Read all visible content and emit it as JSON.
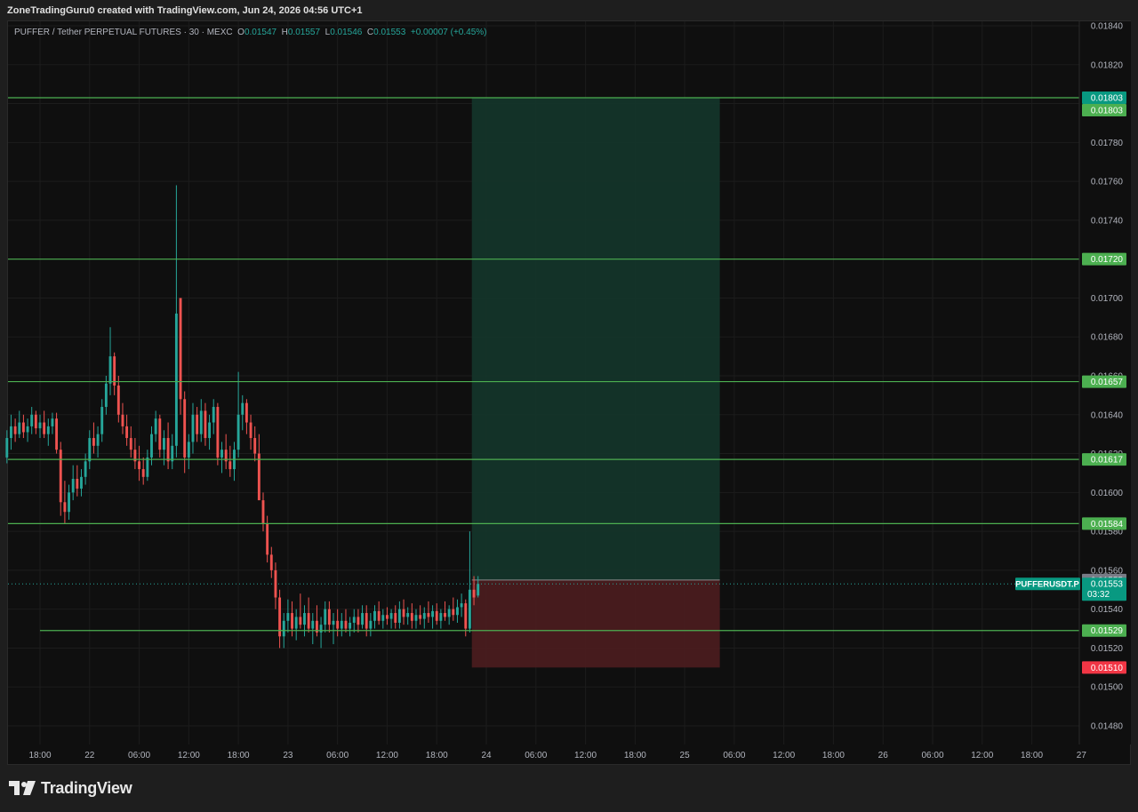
{
  "header": {
    "attribution": "ZoneTradingGuru0 created with TradingView.com, Jun 24, 2026 04:56 UTC+1"
  },
  "legend": {
    "title": "PUFFER / Tether PERPETUAL FUTURES · 30 · MEXC",
    "o_label": "O",
    "o": "0.01547",
    "h_label": "H",
    "h": "0.01557",
    "l_label": "L",
    "l": "0.01546",
    "c_label": "C",
    "c": "0.01553",
    "change": "+0.00007 (+0.45%)"
  },
  "footer": {
    "logo_text": "TradingView",
    "logo_icon": "tradingview-logo-icon"
  },
  "colors": {
    "up": "#26a69a",
    "down": "#ef5350",
    "level_line": "#4caf50",
    "tp_zone": "#14352a",
    "sl_zone": "#4a1c1f",
    "background": "#0f0f0f"
  },
  "chart_data": {
    "type": "candlestick",
    "symbol": "PUFFERUSDT.P",
    "interval": "30",
    "exchange": "MEXC",
    "ylim": [
      0.01472,
      0.01843
    ],
    "y_ticks": [
      "0.01840",
      "0.01820",
      "0.01800",
      "0.01780",
      "0.01760",
      "0.01740",
      "0.01720",
      "0.01700",
      "0.01680",
      "0.01660",
      "0.01640",
      "0.01620",
      "0.01600",
      "0.01580",
      "0.01560",
      "0.01540",
      "0.01520",
      "0.01500",
      "0.01480"
    ],
    "x_ticks": [
      {
        "label": "18:00",
        "t": 0
      },
      {
        "label": "22",
        "t": 12
      },
      {
        "label": "06:00",
        "t": 24
      },
      {
        "label": "12:00",
        "t": 36
      },
      {
        "label": "18:00",
        "t": 48
      },
      {
        "label": "23",
        "t": 60
      },
      {
        "label": "06:00",
        "t": 72
      },
      {
        "label": "12:00",
        "t": 84
      },
      {
        "label": "18:00",
        "t": 96
      },
      {
        "label": "24",
        "t": 108
      },
      {
        "label": "06:00",
        "t": 120
      },
      {
        "label": "12:00",
        "t": 132
      },
      {
        "label": "18:00",
        "t": 144
      },
      {
        "label": "25",
        "t": 156
      },
      {
        "label": "06:00",
        "t": 168
      },
      {
        "label": "12:00",
        "t": 180
      },
      {
        "label": "18:00",
        "t": 192
      },
      {
        "label": "26",
        "t": 204
      },
      {
        "label": "06:00",
        "t": 216
      },
      {
        "label": "12:00",
        "t": 228
      },
      {
        "label": "18:00",
        "t": 240
      },
      {
        "label": "27",
        "t": 252
      }
    ],
    "x_range": [
      -8,
      252
    ],
    "series": [
      {
        "t": -8,
        "o": 0.01618,
        "h": 0.01632,
        "l": 0.01615,
        "c": 0.01628
      },
      {
        "t": -7,
        "o": 0.01628,
        "h": 0.0164,
        "l": 0.01622,
        "c": 0.01634
      },
      {
        "t": -6,
        "o": 0.01634,
        "h": 0.01638,
        "l": 0.01626,
        "c": 0.0163
      },
      {
        "t": -5,
        "o": 0.0163,
        "h": 0.01642,
        "l": 0.01628,
        "c": 0.01636
      },
      {
        "t": -4,
        "o": 0.01636,
        "h": 0.0164,
        "l": 0.01628,
        "c": 0.01631
      },
      {
        "t": -3,
        "o": 0.01631,
        "h": 0.01638,
        "l": 0.01626,
        "c": 0.01634
      },
      {
        "t": -2,
        "o": 0.01634,
        "h": 0.01644,
        "l": 0.0163,
        "c": 0.0164
      },
      {
        "t": -1,
        "o": 0.0164,
        "h": 0.01642,
        "l": 0.0163,
        "c": 0.01633
      },
      {
        "t": 0,
        "o": 0.01633,
        "h": 0.0164,
        "l": 0.01628,
        "c": 0.01636
      },
      {
        "t": 1,
        "o": 0.01636,
        "h": 0.01642,
        "l": 0.01628,
        "c": 0.0163
      },
      {
        "t": 2,
        "o": 0.0163,
        "h": 0.01638,
        "l": 0.01624,
        "c": 0.01634
      },
      {
        "t": 3,
        "o": 0.01634,
        "h": 0.01641,
        "l": 0.0163,
        "c": 0.01638
      },
      {
        "t": 4,
        "o": 0.01638,
        "h": 0.01641,
        "l": 0.0162,
        "c": 0.01622
      },
      {
        "t": 5,
        "o": 0.01622,
        "h": 0.01626,
        "l": 0.01588,
        "c": 0.01595
      },
      {
        "t": 6,
        "o": 0.01595,
        "h": 0.01606,
        "l": 0.01584,
        "c": 0.0159
      },
      {
        "t": 7,
        "o": 0.0159,
        "h": 0.01604,
        "l": 0.01586,
        "c": 0.016
      },
      {
        "t": 8,
        "o": 0.016,
        "h": 0.01614,
        "l": 0.01596,
        "c": 0.01607
      },
      {
        "t": 9,
        "o": 0.01607,
        "h": 0.01614,
        "l": 0.01598,
        "c": 0.01602
      },
      {
        "t": 10,
        "o": 0.01602,
        "h": 0.01612,
        "l": 0.01598,
        "c": 0.01608
      },
      {
        "t": 11,
        "o": 0.01608,
        "h": 0.0162,
        "l": 0.01604,
        "c": 0.01616
      },
      {
        "t": 12,
        "o": 0.01616,
        "h": 0.01632,
        "l": 0.01612,
        "c": 0.01628
      },
      {
        "t": 13,
        "o": 0.01628,
        "h": 0.01636,
        "l": 0.0162,
        "c": 0.01624
      },
      {
        "t": 14,
        "o": 0.01624,
        "h": 0.01634,
        "l": 0.01618,
        "c": 0.0163
      },
      {
        "t": 15,
        "o": 0.0163,
        "h": 0.01648,
        "l": 0.01626,
        "c": 0.01644
      },
      {
        "t": 16,
        "o": 0.01644,
        "h": 0.0166,
        "l": 0.0164,
        "c": 0.01656
      },
      {
        "t": 17,
        "o": 0.01656,
        "h": 0.01685,
        "l": 0.0165,
        "c": 0.0167
      },
      {
        "t": 18,
        "o": 0.0167,
        "h": 0.01672,
        "l": 0.0165,
        "c": 0.01655
      },
      {
        "t": 19,
        "o": 0.01655,
        "h": 0.0166,
        "l": 0.01636,
        "c": 0.0164
      },
      {
        "t": 20,
        "o": 0.0164,
        "h": 0.01646,
        "l": 0.0163,
        "c": 0.01634
      },
      {
        "t": 21,
        "o": 0.01634,
        "h": 0.0164,
        "l": 0.01624,
        "c": 0.01628
      },
      {
        "t": 22,
        "o": 0.01628,
        "h": 0.01634,
        "l": 0.01618,
        "c": 0.01622
      },
      {
        "t": 23,
        "o": 0.01622,
        "h": 0.01628,
        "l": 0.01612,
        "c": 0.01616
      },
      {
        "t": 24,
        "o": 0.01616,
        "h": 0.01624,
        "l": 0.01606,
        "c": 0.01612
      },
      {
        "t": 25,
        "o": 0.01612,
        "h": 0.01618,
        "l": 0.01604,
        "c": 0.01608
      },
      {
        "t": 26,
        "o": 0.01608,
        "h": 0.01622,
        "l": 0.01606,
        "c": 0.01618
      },
      {
        "t": 27,
        "o": 0.01618,
        "h": 0.01634,
        "l": 0.01614,
        "c": 0.0163
      },
      {
        "t": 28,
        "o": 0.0163,
        "h": 0.01642,
        "l": 0.01626,
        "c": 0.01638
      },
      {
        "t": 29,
        "o": 0.01638,
        "h": 0.0164,
        "l": 0.01618,
        "c": 0.01622
      },
      {
        "t": 30,
        "o": 0.01622,
        "h": 0.01632,
        "l": 0.01614,
        "c": 0.01628
      },
      {
        "t": 31,
        "o": 0.01628,
        "h": 0.01636,
        "l": 0.01612,
        "c": 0.01616
      },
      {
        "t": 32,
        "o": 0.01616,
        "h": 0.0163,
        "l": 0.01612,
        "c": 0.01624
      },
      {
        "t": 33,
        "o": 0.01624,
        "h": 0.01758,
        "l": 0.01618,
        "c": 0.01692
      },
      {
        "t": 34,
        "o": 0.017,
        "h": 0.017,
        "l": 0.0164,
        "c": 0.01648
      },
      {
        "t": 35,
        "o": 0.01648,
        "h": 0.01652,
        "l": 0.0161,
        "c": 0.01618
      },
      {
        "t": 36,
        "o": 0.01618,
        "h": 0.0163,
        "l": 0.01612,
        "c": 0.01626
      },
      {
        "t": 37,
        "o": 0.01626,
        "h": 0.01646,
        "l": 0.0162,
        "c": 0.0164
      },
      {
        "t": 38,
        "o": 0.0164,
        "h": 0.01644,
        "l": 0.01626,
        "c": 0.0163
      },
      {
        "t": 39,
        "o": 0.0163,
        "h": 0.01648,
        "l": 0.01626,
        "c": 0.01642
      },
      {
        "t": 40,
        "o": 0.01642,
        "h": 0.01646,
        "l": 0.01624,
        "c": 0.01628
      },
      {
        "t": 41,
        "o": 0.01628,
        "h": 0.0164,
        "l": 0.01622,
        "c": 0.01636
      },
      {
        "t": 42,
        "o": 0.01636,
        "h": 0.01648,
        "l": 0.0163,
        "c": 0.01644
      },
      {
        "t": 43,
        "o": 0.01644,
        "h": 0.01646,
        "l": 0.01614,
        "c": 0.01618
      },
      {
        "t": 44,
        "o": 0.01618,
        "h": 0.01626,
        "l": 0.0161,
        "c": 0.01622
      },
      {
        "t": 45,
        "o": 0.01622,
        "h": 0.0163,
        "l": 0.01612,
        "c": 0.01616
      },
      {
        "t": 46,
        "o": 0.01616,
        "h": 0.01624,
        "l": 0.01608,
        "c": 0.01612
      },
      {
        "t": 47,
        "o": 0.01612,
        "h": 0.01626,
        "l": 0.01606,
        "c": 0.01622
      },
      {
        "t": 48,
        "o": 0.01622,
        "h": 0.01662,
        "l": 0.01618,
        "c": 0.0164
      },
      {
        "t": 49,
        "o": 0.0164,
        "h": 0.0165,
        "l": 0.01632,
        "c": 0.01646
      },
      {
        "t": 50,
        "o": 0.01646,
        "h": 0.01648,
        "l": 0.0163,
        "c": 0.01636
      },
      {
        "t": 51,
        "o": 0.01636,
        "h": 0.0164,
        "l": 0.01622,
        "c": 0.01628
      },
      {
        "t": 52,
        "o": 0.01628,
        "h": 0.01634,
        "l": 0.01616,
        "c": 0.0162
      },
      {
        "t": 53,
        "o": 0.0162,
        "h": 0.0163,
        "l": 0.016,
        "c": 0.01596
      },
      {
        "t": 54,
        "o": 0.01596,
        "h": 0.016,
        "l": 0.0158,
        "c": 0.01584
      },
      {
        "t": 55,
        "o": 0.01584,
        "h": 0.01588,
        "l": 0.01564,
        "c": 0.01568
      },
      {
        "t": 56,
        "o": 0.01568,
        "h": 0.01572,
        "l": 0.01556,
        "c": 0.0156
      },
      {
        "t": 57,
        "o": 0.0156,
        "h": 0.01564,
        "l": 0.0154,
        "c": 0.01546
      },
      {
        "t": 58,
        "o": 0.01546,
        "h": 0.0155,
        "l": 0.0152,
        "c": 0.01526
      },
      {
        "t": 59,
        "o": 0.01526,
        "h": 0.01538,
        "l": 0.0152,
        "c": 0.01534
      },
      {
        "t": 60,
        "o": 0.01534,
        "h": 0.01545,
        "l": 0.01528,
        "c": 0.01538
      },
      {
        "t": 61,
        "o": 0.01538,
        "h": 0.01544,
        "l": 0.01526,
        "c": 0.0153
      },
      {
        "t": 62,
        "o": 0.0153,
        "h": 0.0154,
        "l": 0.01524,
        "c": 0.01536
      },
      {
        "t": 63,
        "o": 0.01536,
        "h": 0.01548,
        "l": 0.0153,
        "c": 0.01532
      },
      {
        "t": 64,
        "o": 0.01532,
        "h": 0.01542,
        "l": 0.01526,
        "c": 0.01538
      },
      {
        "t": 65,
        "o": 0.01538,
        "h": 0.01546,
        "l": 0.01528,
        "c": 0.0153
      },
      {
        "t": 66,
        "o": 0.0153,
        "h": 0.01538,
        "l": 0.01522,
        "c": 0.01534
      },
      {
        "t": 67,
        "o": 0.01534,
        "h": 0.01542,
        "l": 0.01526,
        "c": 0.01528
      },
      {
        "t": 68,
        "o": 0.01528,
        "h": 0.01536,
        "l": 0.0152,
        "c": 0.01532
      },
      {
        "t": 69,
        "o": 0.01532,
        "h": 0.01544,
        "l": 0.01528,
        "c": 0.0154
      },
      {
        "t": 70,
        "o": 0.0154,
        "h": 0.01544,
        "l": 0.01528,
        "c": 0.01532
      },
      {
        "t": 71,
        "o": 0.01532,
        "h": 0.01538,
        "l": 0.01522,
        "c": 0.01534
      },
      {
        "t": 72,
        "o": 0.01534,
        "h": 0.0154,
        "l": 0.01526,
        "c": 0.0153
      },
      {
        "t": 73,
        "o": 0.0153,
        "h": 0.01538,
        "l": 0.01526,
        "c": 0.01534
      },
      {
        "t": 74,
        "o": 0.01534,
        "h": 0.0154,
        "l": 0.01528,
        "c": 0.0153
      },
      {
        "t": 75,
        "o": 0.0153,
        "h": 0.01536,
        "l": 0.01526,
        "c": 0.01533
      },
      {
        "t": 76,
        "o": 0.01533,
        "h": 0.0154,
        "l": 0.01528,
        "c": 0.01536
      },
      {
        "t": 77,
        "o": 0.01536,
        "h": 0.0154,
        "l": 0.01528,
        "c": 0.01532
      },
      {
        "t": 78,
        "o": 0.01532,
        "h": 0.01542,
        "l": 0.0153,
        "c": 0.01538
      },
      {
        "t": 79,
        "o": 0.01538,
        "h": 0.01542,
        "l": 0.01526,
        "c": 0.0153
      },
      {
        "t": 80,
        "o": 0.0153,
        "h": 0.01538,
        "l": 0.01526,
        "c": 0.01534
      },
      {
        "t": 81,
        "o": 0.01534,
        "h": 0.01542,
        "l": 0.0153,
        "c": 0.01539
      },
      {
        "t": 82,
        "o": 0.01539,
        "h": 0.01544,
        "l": 0.01532,
        "c": 0.01534
      },
      {
        "t": 83,
        "o": 0.01534,
        "h": 0.0154,
        "l": 0.0153,
        "c": 0.01537
      },
      {
        "t": 84,
        "o": 0.01537,
        "h": 0.01541,
        "l": 0.01532,
        "c": 0.01535
      },
      {
        "t": 85,
        "o": 0.01535,
        "h": 0.0154,
        "l": 0.0153,
        "c": 0.01538
      },
      {
        "t": 86,
        "o": 0.01538,
        "h": 0.01542,
        "l": 0.0153,
        "c": 0.01533
      },
      {
        "t": 87,
        "o": 0.01533,
        "h": 0.01544,
        "l": 0.0153,
        "c": 0.0154
      },
      {
        "t": 88,
        "o": 0.0154,
        "h": 0.01545,
        "l": 0.01532,
        "c": 0.01536
      },
      {
        "t": 89,
        "o": 0.01536,
        "h": 0.01541,
        "l": 0.01532,
        "c": 0.01538
      },
      {
        "t": 90,
        "o": 0.01538,
        "h": 0.01543,
        "l": 0.0153,
        "c": 0.01534
      },
      {
        "t": 91,
        "o": 0.01534,
        "h": 0.0154,
        "l": 0.0153,
        "c": 0.01537
      },
      {
        "t": 92,
        "o": 0.01537,
        "h": 0.01542,
        "l": 0.01532,
        "c": 0.01535
      },
      {
        "t": 93,
        "o": 0.01535,
        "h": 0.01541,
        "l": 0.0153,
        "c": 0.01538
      },
      {
        "t": 94,
        "o": 0.01538,
        "h": 0.01544,
        "l": 0.01533,
        "c": 0.01536
      },
      {
        "t": 95,
        "o": 0.01536,
        "h": 0.01542,
        "l": 0.0153,
        "c": 0.01539
      },
      {
        "t": 96,
        "o": 0.01539,
        "h": 0.01543,
        "l": 0.01532,
        "c": 0.01534
      },
      {
        "t": 97,
        "o": 0.01534,
        "h": 0.0154,
        "l": 0.0153,
        "c": 0.01538
      },
      {
        "t": 98,
        "o": 0.01538,
        "h": 0.01544,
        "l": 0.01534,
        "c": 0.01536
      },
      {
        "t": 99,
        "o": 0.01536,
        "h": 0.01542,
        "l": 0.01532,
        "c": 0.0154
      },
      {
        "t": 100,
        "o": 0.0154,
        "h": 0.01546,
        "l": 0.01534,
        "c": 0.01537
      },
      {
        "t": 101,
        "o": 0.01537,
        "h": 0.01545,
        "l": 0.01533,
        "c": 0.01541
      },
      {
        "t": 102,
        "o": 0.01541,
        "h": 0.01548,
        "l": 0.01536,
        "c": 0.01543
      },
      {
        "t": 103,
        "o": 0.01543,
        "h": 0.01545,
        "l": 0.01526,
        "c": 0.0153
      },
      {
        "t": 104,
        "o": 0.0153,
        "h": 0.0158,
        "l": 0.01528,
        "c": 0.0155
      },
      {
        "t": 105,
        "o": 0.0155,
        "h": 0.01557,
        "l": 0.01542,
        "c": 0.01546
      },
      {
        "t": 106,
        "o": 0.01547,
        "h": 0.01557,
        "l": 0.01546,
        "c": 0.01553
      }
    ],
    "levels": [
      {
        "price": 0.01803,
        "label": "0.01803"
      },
      {
        "price": 0.0172,
        "label": "0.01720"
      },
      {
        "price": 0.01657,
        "label": "0.01657"
      },
      {
        "price": 0.01617,
        "label": "0.01617"
      },
      {
        "price": 0.01584,
        "label": "0.01584"
      },
      {
        "price": 0.01529,
        "label": "0.01529",
        "start_t": 0
      }
    ],
    "position": {
      "type": "long",
      "start_t": 104.5,
      "end_t": 164.5,
      "entry": 0.01555,
      "target": 0.01803,
      "stop": 0.0151,
      "target_label": "0.01803",
      "entry_label": "0.01555",
      "stop_label": "0.01510"
    },
    "last_price": {
      "symbol": "PUFFERUSDT.P",
      "value": "0.01553",
      "countdown": "03:32",
      "price": 0.01553
    }
  }
}
